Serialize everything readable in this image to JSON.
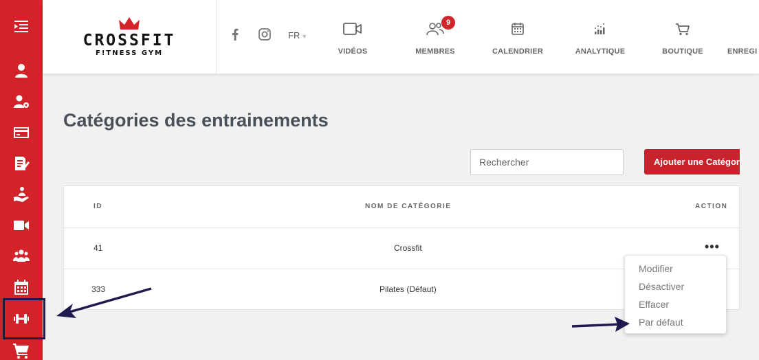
{
  "brand": {
    "name": "CROSSFIT",
    "tagline": "F!TNESS GYM"
  },
  "header": {
    "language": "FR",
    "nav": [
      {
        "label": "VIDÉOS",
        "icon": "video-icon"
      },
      {
        "label": "MEMBRES",
        "icon": "members-icon",
        "badge": "9"
      },
      {
        "label": "CALENDRIER",
        "icon": "calendar-icon"
      },
      {
        "label": "ANALYTIQUE",
        "icon": "analytics-icon"
      },
      {
        "label": "BOUTIQUE",
        "icon": "cart-icon"
      },
      {
        "label": "ENREGI",
        "icon": ""
      }
    ]
  },
  "sidebar": {
    "items": [
      {
        "icon": "menu-toggle-icon"
      },
      {
        "icon": "user-icon"
      },
      {
        "icon": "user-settings-icon"
      },
      {
        "icon": "credit-card-icon"
      },
      {
        "icon": "edit-document-icon"
      },
      {
        "icon": "hand-user-icon"
      },
      {
        "icon": "video-camera-icon"
      },
      {
        "icon": "group-icon"
      },
      {
        "icon": "calendar-icon"
      },
      {
        "icon": "dumbbell-icon",
        "active": true
      },
      {
        "icon": "shopping-cart-icon"
      }
    ]
  },
  "main": {
    "title": "Catégories des entrainements",
    "search_placeholder": "Rechercher",
    "add_button": "Ajouter une Catégorie"
  },
  "table": {
    "columns": [
      "ID",
      "NOM DE CATÉGORIE",
      "ACTION"
    ],
    "rows": [
      {
        "id": "41",
        "name": "Crossfit"
      },
      {
        "id": "333",
        "name": "Pilates (Défaut)"
      }
    ]
  },
  "action_menu": {
    "items": [
      "Modifier",
      "Désactiver",
      "Effacer",
      "Par défaut"
    ]
  },
  "colors": {
    "accent": "#d2232a",
    "annotation": "#1f1a4d"
  }
}
